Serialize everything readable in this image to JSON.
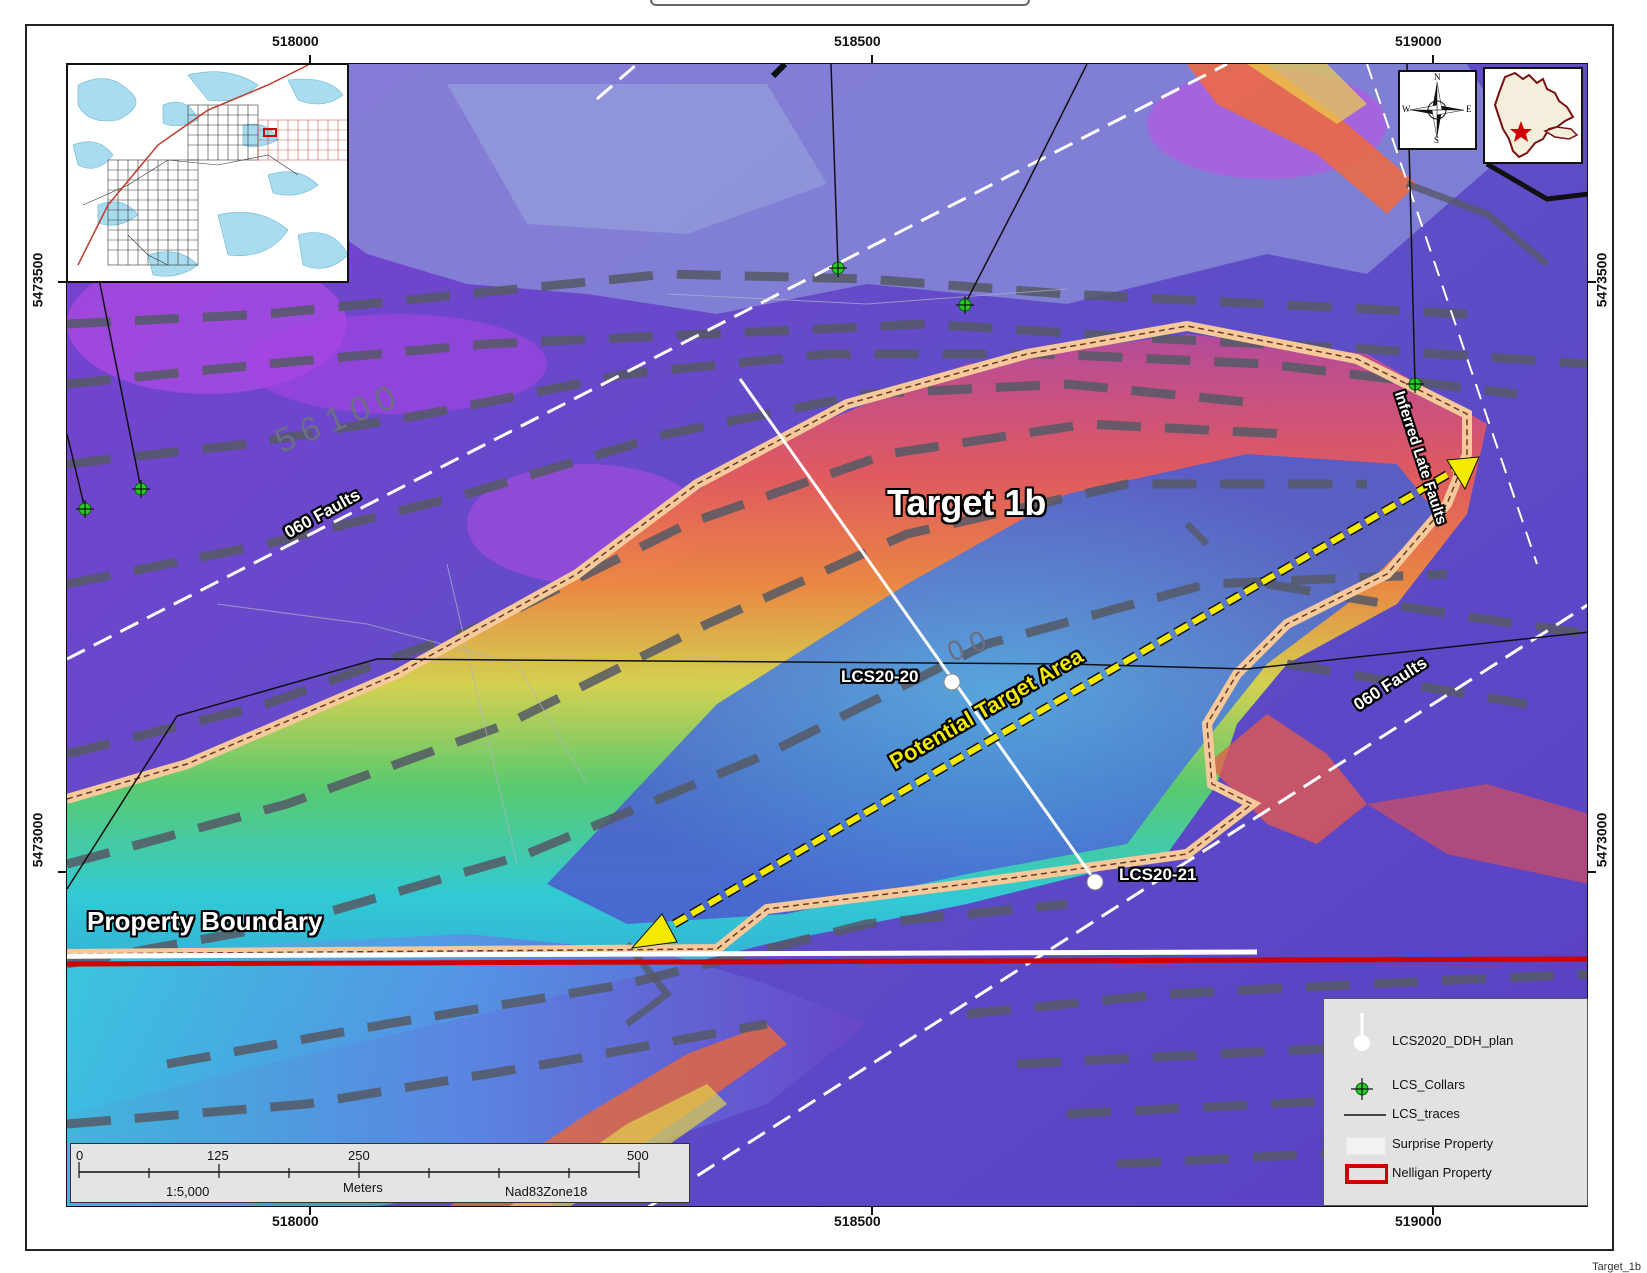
{
  "map": {
    "target_label": "Target 1b",
    "property_boundary_label": "Property Boundary",
    "potential_target_label": "Potential Target Area",
    "fault_label_upper": "060 Faults",
    "fault_label_lower": "060 Faults",
    "inferred_fault_label": "Inferred Late Faults",
    "hole_1": "LCS20-20",
    "hole_2": "LCS20-21",
    "contour_label_1": "56100",
    "contour_label_2": "00"
  },
  "grid": {
    "easting": [
      "518000",
      "518500",
      "519000"
    ],
    "northing": [
      "5473500",
      "5473000"
    ]
  },
  "compass": {
    "n": "N",
    "s": "S",
    "e": "E",
    "w": "W"
  },
  "scalebar": {
    "ticks": [
      "0",
      "125",
      "250",
      "500"
    ],
    "scale": "1:5,000",
    "units": "Meters",
    "datum": "Nad83Zone18"
  },
  "legend": {
    "items": [
      {
        "label": "LCS2020_DDH_plan",
        "icon": "drillhole-plan-icon"
      },
      {
        "label": "LCS_Collars",
        "icon": "collar-icon"
      },
      {
        "label": "LCS_traces",
        "icon": "trace-line-icon"
      },
      {
        "label": "Surprise Property",
        "icon": "surprise-property-swatch"
      },
      {
        "label": "Nelligan Property",
        "icon": "nelligan-property-swatch"
      }
    ]
  },
  "footnote": "Target_1b",
  "colors": {
    "nelligan": "#d10000",
    "target_outline": "#f5c99a",
    "potential_arrow": "#f4ea00",
    "collar": "#1fcf1f"
  }
}
